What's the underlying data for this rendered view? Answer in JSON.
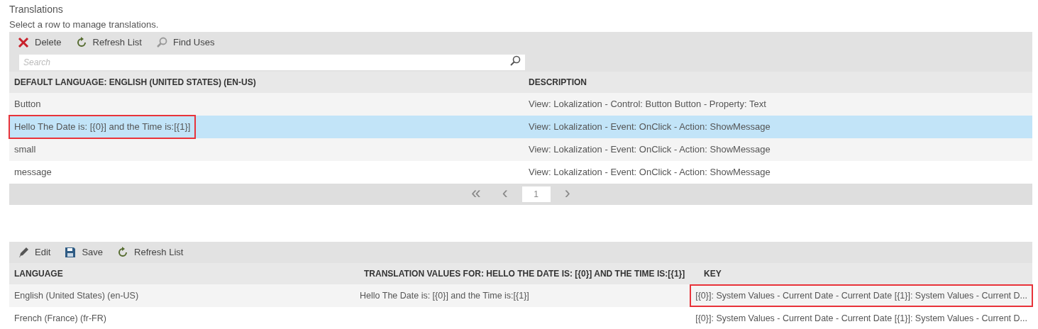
{
  "title": "Translations",
  "subtitle": "Select a row to manage translations.",
  "top_toolbar": [
    {
      "kind": "delete",
      "label": "Delete"
    },
    {
      "kind": "refresh",
      "label": "Refresh List"
    },
    {
      "kind": "find",
      "label": "Find Uses"
    }
  ],
  "search": {
    "placeholder": "Search"
  },
  "top_table": {
    "columns": [
      "DEFAULT LANGUAGE: ENGLISH (UNITED STATES) (EN-US)",
      "DESCRIPTION"
    ],
    "rows": [
      {
        "selected": false,
        "cells": [
          {
            "text": "Button",
            "highlighted": false
          },
          {
            "text": "View: Lokalization - Control: Button Button - Property: Text",
            "highlighted": false
          }
        ]
      },
      {
        "selected": true,
        "cells": [
          {
            "text": "Hello The Date is: [{0}] and the Time is:[{1}]",
            "highlighted": true
          },
          {
            "text": "View: Lokalization - Event: OnClick - Action: ShowMessage",
            "highlighted": false
          }
        ]
      },
      {
        "selected": false,
        "cells": [
          {
            "text": "small",
            "highlighted": false
          },
          {
            "text": "View: Lokalization - Event: OnClick - Action: ShowMessage",
            "highlighted": false
          }
        ]
      },
      {
        "selected": false,
        "cells": [
          {
            "text": "message",
            "highlighted": false
          },
          {
            "text": "View: Lokalization - Event: OnClick - Action: ShowMessage",
            "highlighted": false
          }
        ]
      }
    ]
  },
  "pager": {
    "first": "«",
    "prev": "‹",
    "page": "1",
    "next": "›"
  },
  "bottom_toolbar": [
    {
      "kind": "edit",
      "label": "Edit"
    },
    {
      "kind": "save",
      "label": "Save"
    },
    {
      "kind": "refresh",
      "label": "Refresh List"
    }
  ],
  "bottom_table": {
    "columns": [
      "LANGUAGE",
      "TRANSLATION VALUES FOR: HELLO THE DATE IS: [{0}] AND THE TIME IS:[{1}]",
      "KEY"
    ],
    "rows": [
      {
        "selected": false,
        "language": {
          "text": "English (United States) (en-US)",
          "highlighted": false
        },
        "translation": {
          "text": "Hello The Date is: [{0}] and the Time is:[{1}]",
          "highlighted": false
        },
        "key": {
          "text": "[{0}]: System Values - Current Date - Current Date [{1}]: System Values - Current D...",
          "highlighted": true
        }
      },
      {
        "selected": false,
        "language": {
          "text": "French (France) (fr-FR)",
          "highlighted": false
        },
        "key": {
          "text": "[{0}]: System Values - Current Date - Current Date [{1}]: System Values - Current D...",
          "highlighted": false
        }
      }
    ]
  }
}
